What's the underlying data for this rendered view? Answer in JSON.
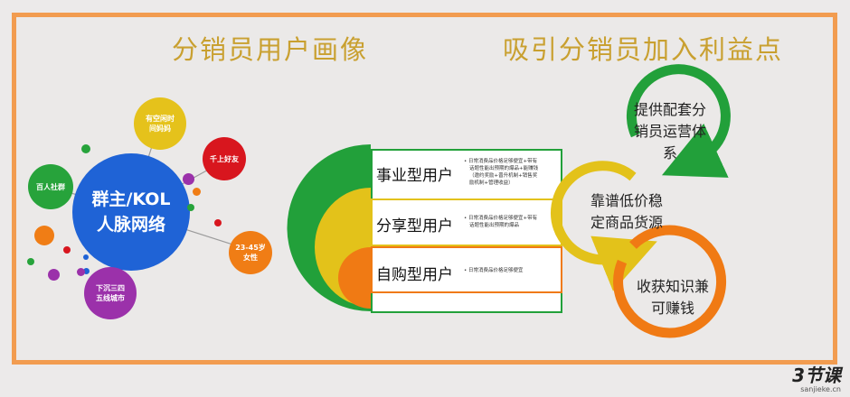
{
  "titles": {
    "left": "分销员用户画像",
    "right": "吸引分销员加入利益点"
  },
  "bubbles": {
    "center": [
      "群主/KOL",
      "人脉网络"
    ],
    "free_time": [
      "有空闲时",
      "间妈妈"
    ],
    "friends": "千上好友",
    "hundred": "百人社群",
    "women": [
      "23-45岁",
      "女性"
    ],
    "cities": [
      "下沉三四",
      "五线城市"
    ]
  },
  "user_types": [
    {
      "label": "事业型用户",
      "desc": [
        "• 日常消费品价格足够便宜+带有",
        "话题性能出预期的爆品+能赚钱",
        "（邀约奖励+晋升机制+销售奖",
        "励机制+管理收益）"
      ]
    },
    {
      "label": "分享型用户",
      "desc": [
        "• 日常消费品价格足够便宜+带有",
        "话题性能出预期的爆品"
      ]
    },
    {
      "label": "自购型用户",
      "desc": [
        "• 日常消费品价格足够便宜"
      ]
    }
  ],
  "benefits": [
    {
      "lines": [
        "提供配套分",
        "销员运营体",
        "系"
      ]
    },
    {
      "lines": [
        "靠谱低价稳",
        "定商品货源"
      ]
    },
    {
      "lines": [
        "收获知识兼",
        "可赚钱"
      ]
    }
  ],
  "logo": {
    "brand": "3节课",
    "site": "sanjieke.cn"
  },
  "colors": {
    "border": "#f29c50",
    "title": "#c9a030",
    "green": "#22a03a",
    "yellow": "#e3c21a",
    "orange": "#f07a14",
    "blue": "#1e64d6",
    "red": "#d9161e",
    "purple": "#9a2fa8"
  }
}
